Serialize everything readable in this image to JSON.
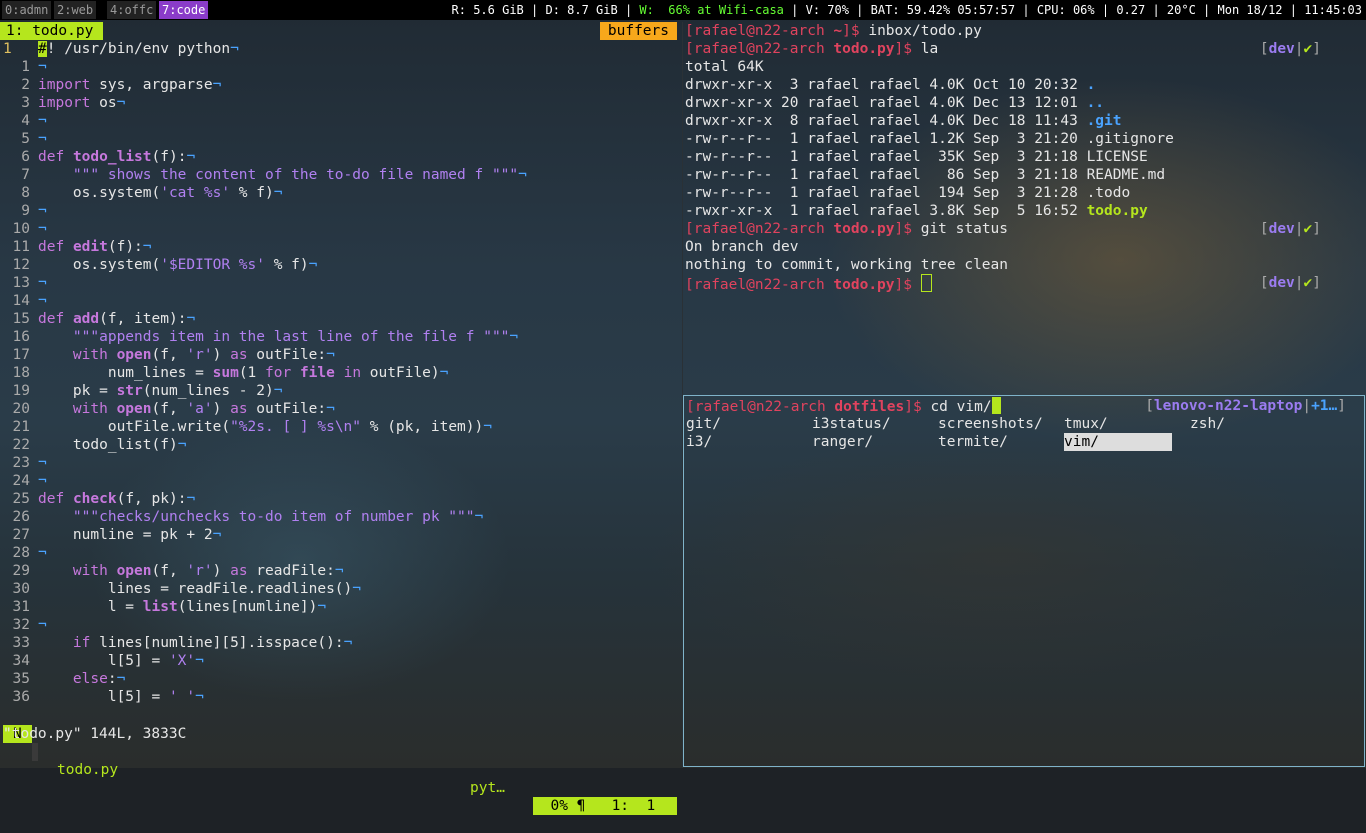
{
  "workspaces": [
    "0:admn",
    "2:web",
    "4:offc",
    "7:code"
  ],
  "status_bar": {
    "ram": "R: 5.6 GiB",
    "disk": "D: 8.7 GiB",
    "wifi": "W:  66% at Wifi-casa",
    "volume": "V: 70%",
    "battery": "BAT: 59.42% 05:57:57",
    "cpu": "CPU: 06%",
    "load": "0.27",
    "temp": "20°C",
    "datetime": "Mon 18/12 | 11:45:03"
  },
  "vim": {
    "tab_label": "1: todo.py",
    "buffers_label": "buffers",
    "lines": [
      {
        "n": "1",
        "t": "#! /usr/bin/env python"
      },
      {
        "n": "1",
        "t": ""
      },
      {
        "n": "2",
        "t": "import sys, argparse"
      },
      {
        "n": "3",
        "t": "import os"
      },
      {
        "n": "4",
        "t": ""
      },
      {
        "n": "5",
        "t": ""
      },
      {
        "n": "6",
        "t": "def todo_list(f):"
      },
      {
        "n": "7",
        "t": "    \"\"\" shows the content of the to-do file named f \"\"\""
      },
      {
        "n": "8",
        "t": "    os.system('cat %s' % f)"
      },
      {
        "n": "9",
        "t": ""
      },
      {
        "n": "10",
        "t": ""
      },
      {
        "n": "11",
        "t": "def edit(f):"
      },
      {
        "n": "12",
        "t": "    os.system('$EDITOR %s' % f)"
      },
      {
        "n": "13",
        "t": ""
      },
      {
        "n": "14",
        "t": ""
      },
      {
        "n": "15",
        "t": "def add(f, item):"
      },
      {
        "n": "16",
        "t": "    \"\"\"appends item in the last line of the file f \"\"\""
      },
      {
        "n": "17",
        "t": "    with open(f, 'r') as outFile:"
      },
      {
        "n": "18",
        "t": "        num_lines = sum(1 for file in outFile)"
      },
      {
        "n": "19",
        "t": "    pk = str(num_lines - 2)"
      },
      {
        "n": "20",
        "t": "    with open(f, 'a') as outFile:"
      },
      {
        "n": "21",
        "t": "        outFile.write(\"%2s. [ ] %s\\n\" % (pk, item))"
      },
      {
        "n": "22",
        "t": "    todo_list(f)"
      },
      {
        "n": "23",
        "t": ""
      },
      {
        "n": "24",
        "t": ""
      },
      {
        "n": "25",
        "t": "def check(f, pk):"
      },
      {
        "n": "26",
        "t": "    \"\"\"checks/unchecks to-do item of number pk \"\"\""
      },
      {
        "n": "27",
        "t": "    numline = pk + 2"
      },
      {
        "n": "28",
        "t": ""
      },
      {
        "n": "29",
        "t": "    with open(f, 'r') as readFile:"
      },
      {
        "n": "30",
        "t": "        lines = readFile.readlines()"
      },
      {
        "n": "31",
        "t": "        l = list(lines[numline])"
      },
      {
        "n": "32",
        "t": ""
      },
      {
        "n": "33",
        "t": "    if lines[numline][5].isspace():"
      },
      {
        "n": "34",
        "t": "        l[5] = 'X'"
      },
      {
        "n": "35",
        "t": "    else:"
      },
      {
        "n": "36",
        "t": "        l[5] = ' '"
      }
    ],
    "statusline": {
      "mode": "N",
      "filename": "todo.py",
      "filetype": "pyt…",
      "position": "  0% ¶   1:  1"
    },
    "cmdline": "\"todo.py\" 144L, 3833C"
  },
  "term1": {
    "prompt_user": "[rafael@n22-arch ",
    "cmd1_dir": "~",
    "cmd1": "inbox/todo.py",
    "cmd2_dir": "todo.py",
    "cmd2": "la",
    "git_branch": "dev",
    "git_check": "✔",
    "ls_total": "total 64K",
    "ls": [
      {
        "meta": "drwxr-xr-x  3 rafael rafael 4.0K Oct 10 20:32 ",
        "name": ".",
        "kind": "dir"
      },
      {
        "meta": "drwxr-xr-x 20 rafael rafael 4.0K Dec 13 12:01 ",
        "name": "..",
        "kind": "dir"
      },
      {
        "meta": "drwxr-xr-x  8 rafael rafael 4.0K Dec 18 11:43 ",
        "name": ".git",
        "kind": "dir"
      },
      {
        "meta": "-rw-r--r--  1 rafael rafael 1.2K Sep  3 21:20 ",
        "name": ".gitignore",
        "kind": "file"
      },
      {
        "meta": "-rw-r--r--  1 rafael rafael  35K Sep  3 21:18 ",
        "name": "LICENSE",
        "kind": "file"
      },
      {
        "meta": "-rw-r--r--  1 rafael rafael   86 Sep  3 21:18 ",
        "name": "README.md",
        "kind": "file"
      },
      {
        "meta": "-rw-r--r--  1 rafael rafael  194 Sep  3 21:28 ",
        "name": ".todo",
        "kind": "file"
      },
      {
        "meta": "-rwxr-xr-x  1 rafael rafael 3.8K Sep  5 16:52 ",
        "name": "todo.py",
        "kind": "exe"
      }
    ],
    "cmd3": "git status",
    "out1": "On branch dev",
    "out2": "nothing to commit, working tree clean"
  },
  "term2": {
    "prompt_user": "[rafael@n22-arch ",
    "dir": "dotfiles",
    "cmd": "cd vim/",
    "host_label": "lenovo-n22-laptop",
    "host_extra": "+1…",
    "completions_row1": [
      "git/",
      "i3status/",
      "screenshots/",
      "tmux/",
      "zsh/"
    ],
    "completions_row2": [
      "i3/",
      "ranger/",
      "termite/",
      "vim/"
    ]
  }
}
